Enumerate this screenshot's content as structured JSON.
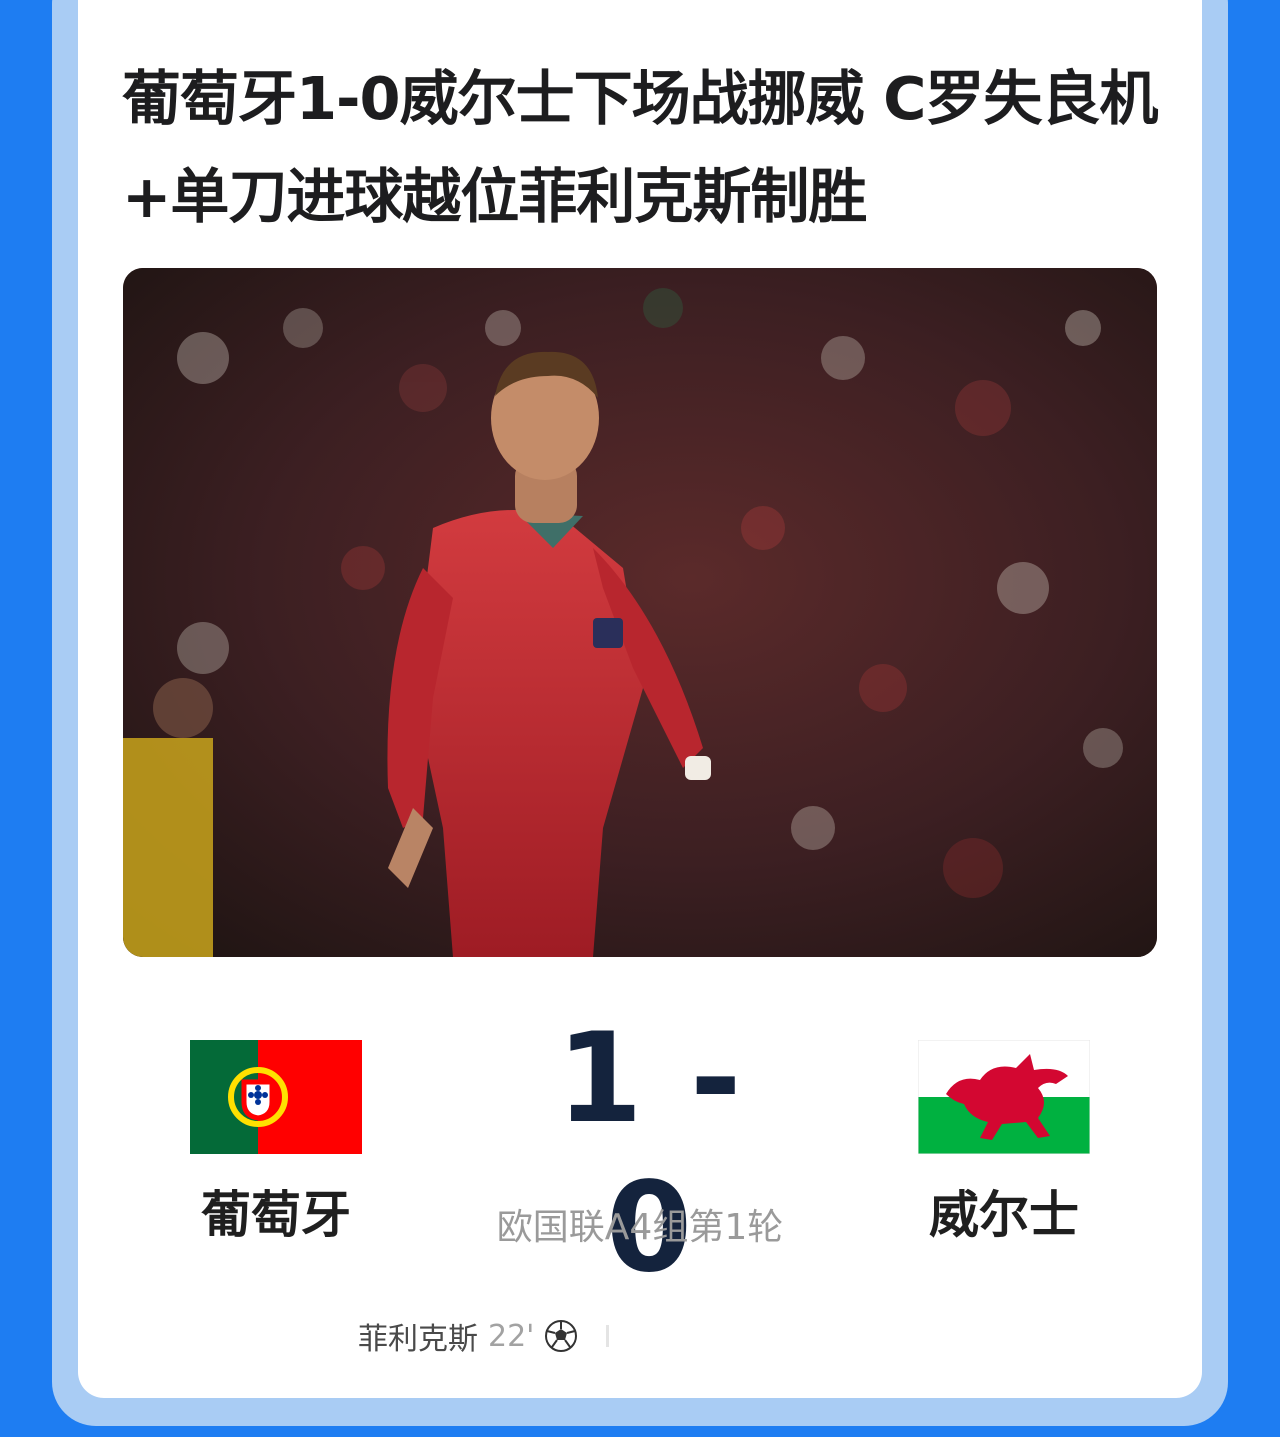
{
  "article": {
    "title": "葡萄牙1-0威尔士下场战挪威 C罗失良机+单刀进球越位菲利克斯制胜"
  },
  "match": {
    "home": {
      "name": "葡萄牙",
      "flag": "portugal-flag"
    },
    "away": {
      "name": "威尔士",
      "flag": "wales-flag"
    },
    "score": "1 - 0",
    "round": "欧国联A4组第1轮",
    "goals": [
      {
        "player": "菲利克斯",
        "minute": "22'",
        "icon": "soccer-ball-icon"
      }
    ]
  },
  "colors": {
    "background": "#1e7df2",
    "score": "#14233d",
    "portugal_green": "#046a38",
    "portugal_red": "#ff0000",
    "wales_green": "#00b140",
    "wales_red": "#d30731"
  }
}
